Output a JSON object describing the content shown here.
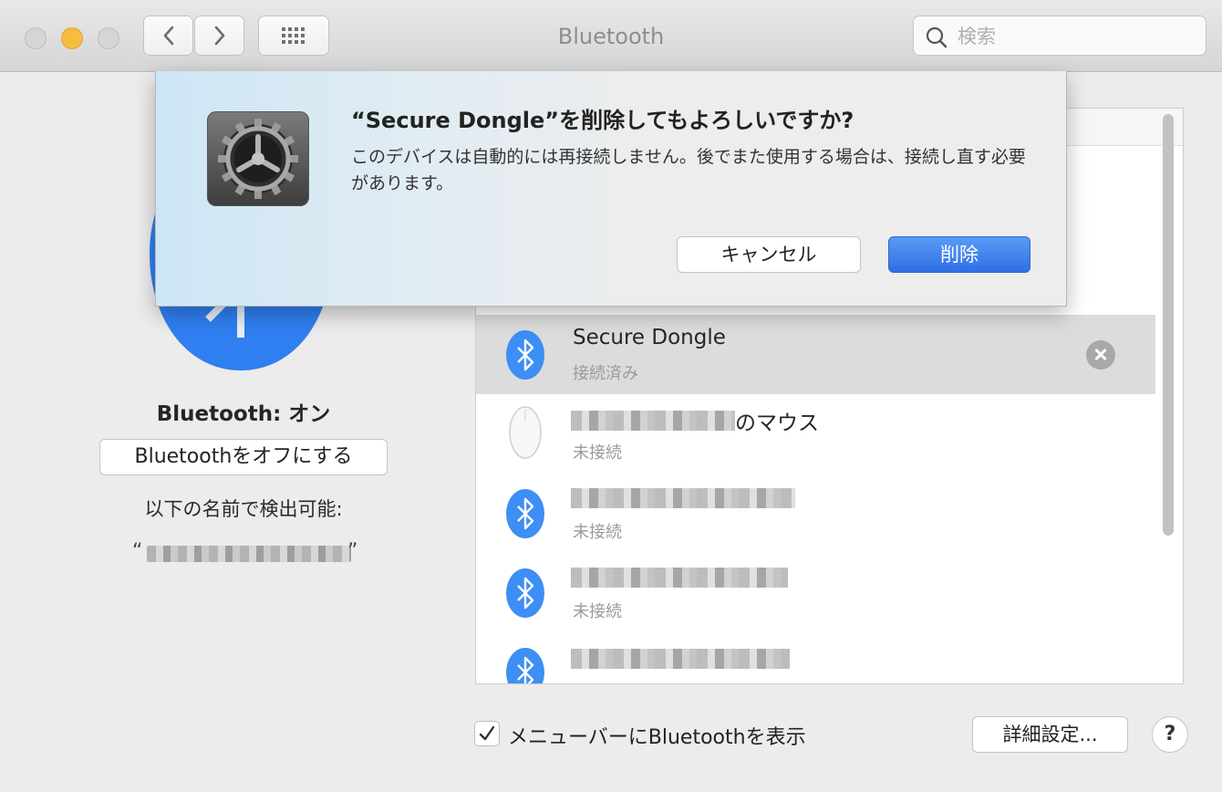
{
  "window": {
    "title": "Bluetooth",
    "search": {
      "placeholder": "検索",
      "value": ""
    }
  },
  "left_panel": {
    "status": "Bluetooth: オン",
    "toggle_label": "Bluetoothをオフにする",
    "discoverable_label": "以下の名前で検出可能:",
    "open_quote": "“",
    "close_quote": "”"
  },
  "devices": [
    {
      "name": "Secure Dongle",
      "status": "接続済み",
      "icon": "bluetooth-icon",
      "selected": true
    },
    {
      "name_suffix": "のマウス",
      "status": "未接続",
      "icon": "mouse-icon"
    },
    {
      "status": "未接続",
      "icon": "bluetooth-icon"
    },
    {
      "status": "未接続",
      "icon": "bluetooth-icon"
    },
    {
      "status": "",
      "icon": "bluetooth-icon"
    }
  ],
  "bottom": {
    "show_in_menubar_label": "メニューバーにBluetoothを表示",
    "show_in_menubar_checked": true,
    "advanced_label": "詳細設定...",
    "help_label": "?"
  },
  "dialog": {
    "title": "“Secure Dongle”を削除してもよろしいですか?",
    "message": "このデバイスは自動的には再接続しません。後でまた使用する場合は、接続し直す必要があります。",
    "cancel_label": "キャンセル",
    "delete_label": "削除"
  },
  "colors": {
    "accent": "#2f6fe6",
    "bluetooth_blue": "#3d8ef5",
    "close_yellow": "#f6be3c"
  }
}
